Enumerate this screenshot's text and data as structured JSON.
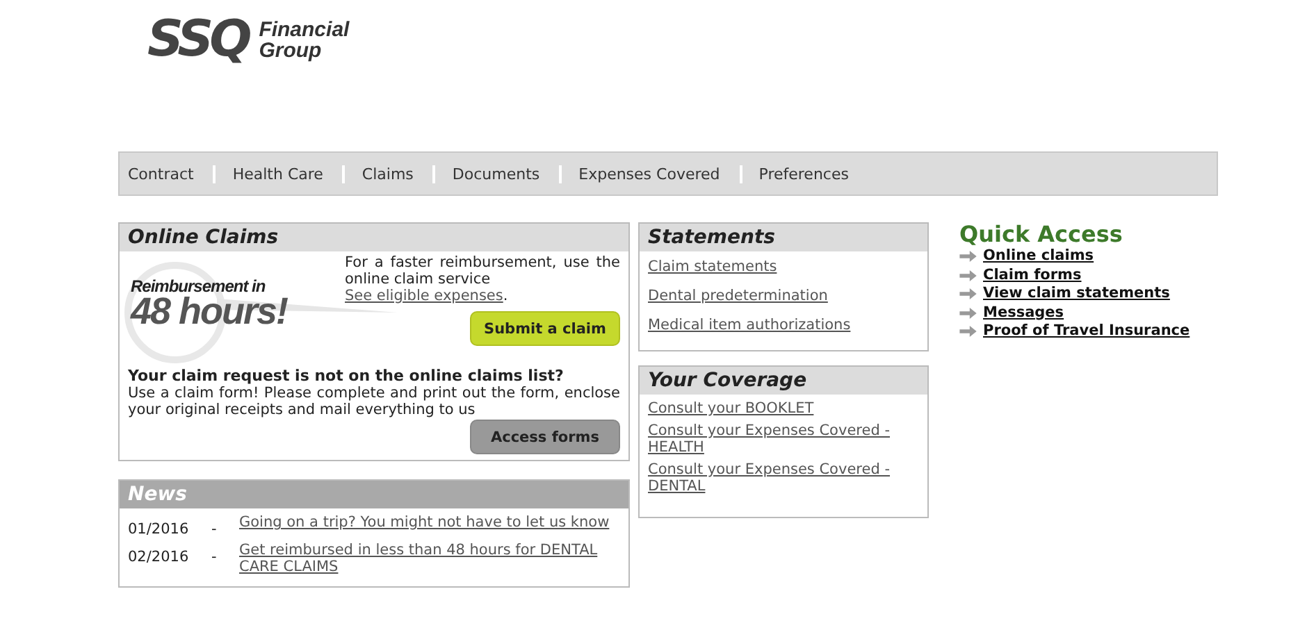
{
  "logo": {
    "mark": "SSQ",
    "line_1": "Financial",
    "line_2": "Group"
  },
  "nav": [
    {
      "label": "Contract"
    },
    {
      "label": "Health Care"
    },
    {
      "label": "Claims"
    },
    {
      "label": "Documents"
    },
    {
      "label": "Expenses Covered"
    },
    {
      "label": "Preferences"
    }
  ],
  "online_claims": {
    "title": "Online Claims",
    "badge_line_1": "Reimbursement in",
    "badge_line_2": "48 hours!",
    "intro": "For a faster reimbursement, use the online claim service",
    "link": "See eligible expenses",
    "link_end": ".",
    "submit_button": "Submit a claim",
    "question": "Your claim request is not on the online claims list?",
    "explanation": "Use a claim form! Please complete and print out the form, enclose your original receipts and mail everything to us",
    "forms_button": "Access forms"
  },
  "news": {
    "title": "News",
    "items": [
      {
        "date": "01/2016",
        "dash": "-",
        "text": "Going on a trip? You might not have to let us know"
      },
      {
        "date": "02/2016",
        "dash": "-",
        "text": "Get reimbursed in less than 48 hours for DENTAL CARE CLAIMS"
      }
    ]
  },
  "statements": {
    "title": "Statements",
    "links": [
      "Claim statements",
      "Dental predetermination",
      "Medical item authorizations"
    ]
  },
  "coverage": {
    "title": "Your Coverage",
    "links": [
      "Consult your BOOKLET",
      "Consult your Expenses Covered - HEALTH",
      "Consult your Expenses Covered - DENTAL"
    ]
  },
  "quick_access": {
    "title": "Quick Access",
    "links": [
      "Online claims",
      "Claim forms",
      "View claim statements",
      "Messages",
      "Proof of Travel Insurance"
    ]
  }
}
